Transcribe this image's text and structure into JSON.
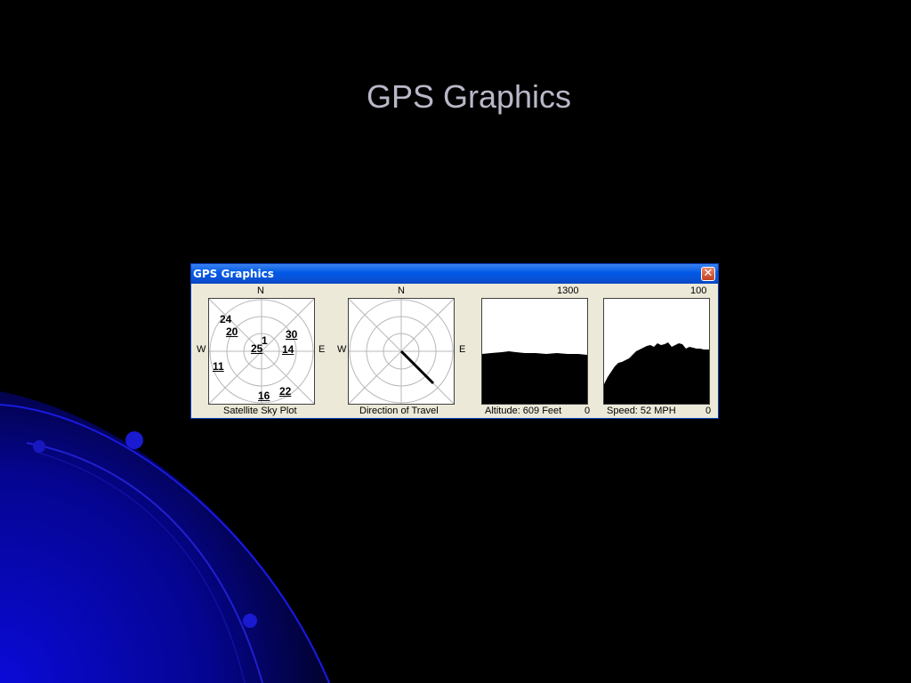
{
  "slide": {
    "title": "GPS Graphics"
  },
  "window": {
    "title": "GPS Graphics",
    "close_symbol": "✕"
  },
  "sky_plot": {
    "compass": {
      "north": "N",
      "west": "W",
      "east": "E"
    },
    "caption": "Satellite Sky Plot",
    "satellites": [
      {
        "id": "24",
        "underlined": false
      },
      {
        "id": "20",
        "underlined": true
      },
      {
        "id": "1",
        "underlined": false
      },
      {
        "id": "30",
        "underlined": true
      },
      {
        "id": "25",
        "underlined": true
      },
      {
        "id": "14",
        "underlined": true
      },
      {
        "id": "11",
        "underlined": true
      },
      {
        "id": "16",
        "underlined": true
      },
      {
        "id": "22",
        "underlined": true
      }
    ]
  },
  "direction": {
    "compass": {
      "north": "N",
      "west": "W",
      "east": "E"
    },
    "caption": "Direction of Travel"
  },
  "altitude": {
    "max_label": "1300",
    "caption": "Altitude: 609 Feet",
    "min_label": "0"
  },
  "speed": {
    "max_label": "100",
    "caption": "Speed: 52 MPH",
    "min_label": "0"
  },
  "colors": {
    "slide_bg": "#000000",
    "window_title_bar": "#0058e6",
    "window_body": "#ece9d8",
    "close_button": "#c2401e",
    "curve_accent": "#1a1aff"
  }
}
